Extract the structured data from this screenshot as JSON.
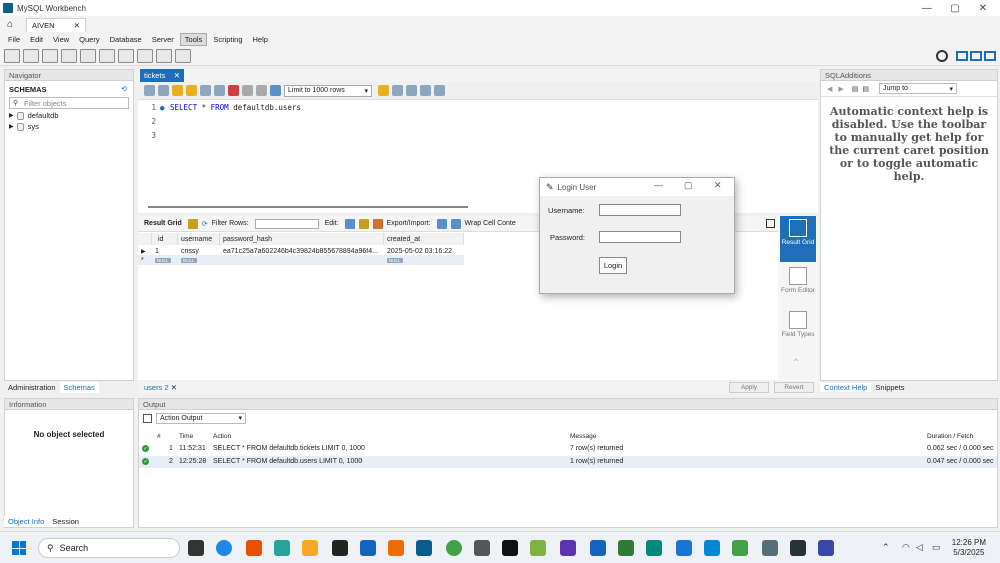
{
  "window": {
    "title": "MySQL Workbench",
    "minimize": "—",
    "maximize": "▢",
    "close": "✕"
  },
  "connection_tab": {
    "label": "AIVEN",
    "close": "✕"
  },
  "menu": [
    "File",
    "Edit",
    "View",
    "Query",
    "Database",
    "Server",
    "Tools",
    "Scripting",
    "Help"
  ],
  "menu_active": "Tools",
  "navigator": {
    "header": "Navigator",
    "schemas_label": "SCHEMAS",
    "filter_placeholder": "Filter objects",
    "schemas": [
      "defaultdb",
      "sys"
    ],
    "tabs": [
      "Administration",
      "Schemas"
    ]
  },
  "information": {
    "header": "Information",
    "no_object": "No object selected",
    "tabs": [
      "Object Info",
      "Session"
    ]
  },
  "editor": {
    "tab_label": "tickets",
    "tab_close": "✕",
    "limit": "Limit to 1000 rows",
    "lines": [
      "1",
      "2",
      "3"
    ],
    "query_kw1": "SELECT",
    "query_mid": " * ",
    "query_kw2": "FROM",
    "query_rest": " defaultdb.users"
  },
  "result": {
    "grid_label": "Result Grid",
    "filter_label": "Filter Rows:",
    "edit_label": "Edit:",
    "export_label": "Export/Import:",
    "wrap_label": "Wrap Cell Conte",
    "columns": [
      "id",
      "username",
      "password_hash",
      "created_at"
    ],
    "row": [
      "1",
      "crissy",
      "ea71c25a7a602246b4c39824b855678894a96f4...",
      "2025-05-02 03:16:22"
    ],
    "null_label": "NULL",
    "bottom_tab": "users 2",
    "apply": "Apply",
    "revert": "Revert",
    "side": [
      "Result Grid",
      "Form Editor",
      "Field Types"
    ]
  },
  "sql_additions": {
    "header": "SQLAdditions",
    "jump_to": "Jump to",
    "help_text": "Automatic context help is disabled. Use the toolbar to manually get help for the current caret position or to toggle automatic help.",
    "tabs": [
      "Context Help",
      "Snippets"
    ]
  },
  "output": {
    "header": "Output",
    "selector": "Action Output",
    "columns": [
      "#",
      "Time",
      "Action",
      "Message",
      "Duration / Fetch"
    ],
    "rows": [
      {
        "n": "1",
        "time": "11:52:31",
        "action": "SELECT * FROM defaultdb.tickets LIMIT 0, 1000",
        "message": "7 row(s) returned",
        "duration": "0.062 sec / 0.000 sec"
      },
      {
        "n": "2",
        "time": "12:25:28",
        "action": "SELECT * FROM defaultdb.users LIMIT 0, 1000",
        "message": "1 row(s) returned",
        "duration": "0.047 sec / 0.000 sec"
      }
    ]
  },
  "dialog": {
    "title": "Login User",
    "username_label": "Username:",
    "password_label": "Password:",
    "login_button": "Login",
    "minimize": "—",
    "maximize": "▢",
    "close": "✕"
  },
  "taskbar": {
    "search": "Search",
    "time": "12:26 PM",
    "date": "5/3/2025"
  }
}
